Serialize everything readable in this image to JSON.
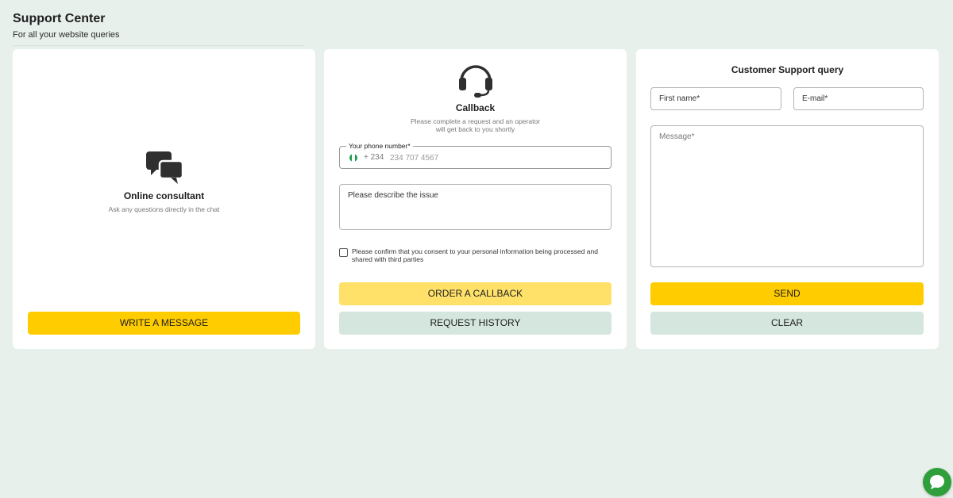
{
  "header": {
    "title": "Support Center",
    "subtitle": "For all your website queries"
  },
  "consultant": {
    "icon": "chat-bubbles-icon",
    "title": "Online consultant",
    "text": "Ask any questions directly in the chat",
    "button_label": "WRITE A MESSAGE"
  },
  "callback": {
    "icon": "headset-icon",
    "title": "Callback",
    "text": "Please complete a request and an operator will get back to you shortly",
    "phone_label": "Your phone number*",
    "dial_code": "+ 234",
    "phone_placeholder": "234 707 4567",
    "issue_placeholder": "Please describe the issue",
    "consent_text": "Please confirm that you consent to your personal information being processed and shared with third parties",
    "order_button_label": "ORDER A CALLBACK",
    "history_button_label": "REQUEST HISTORY"
  },
  "query": {
    "title": "Customer Support query",
    "first_name_placeholder": "First name*",
    "email_placeholder": "E-mail*",
    "message_placeholder": "Message*",
    "send_button_label": "SEND",
    "clear_button_label": "CLEAR"
  },
  "colors": {
    "background": "#e8f0ec",
    "accent_yellow": "#ffcc00",
    "accent_yellow_light": "#ffe16a",
    "secondary_button": "#d4e6de",
    "chat_fab": "#2e9f3a"
  },
  "chat_widget": {
    "icon": "chat-bubble-icon"
  }
}
